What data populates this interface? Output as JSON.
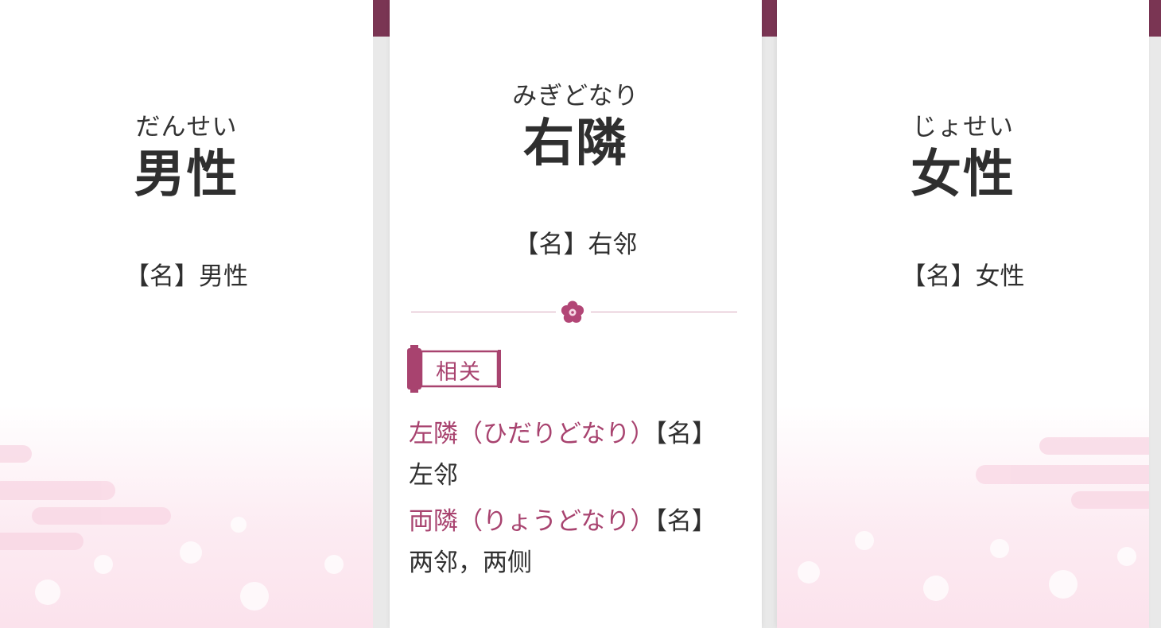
{
  "cards": {
    "left": {
      "reading": "だんせい",
      "headword": "男性",
      "meaning": "【名】男性"
    },
    "middle": {
      "reading": "みぎどなり",
      "headword": "右隣",
      "meaning": "【名】右邻",
      "related_label": "相关",
      "related": [
        {
          "word": "左隣（ひだりどなり）",
          "pos": "【名】",
          "meaning": "左邻"
        },
        {
          "word": "両隣（りょうどなり）",
          "pos": "【名】",
          "meaning": "两邻，两侧"
        }
      ]
    },
    "right": {
      "reading": "じょせい",
      "headword": "女性",
      "meaning": "【名】女性"
    }
  },
  "colors": {
    "accent": "#a8436f",
    "header_strip": "#7a3553",
    "sakura_bg": "#fbe2ec"
  },
  "icons": {
    "divider": "sakura-flower-icon",
    "related_tag": "scroll-tag-icon"
  }
}
